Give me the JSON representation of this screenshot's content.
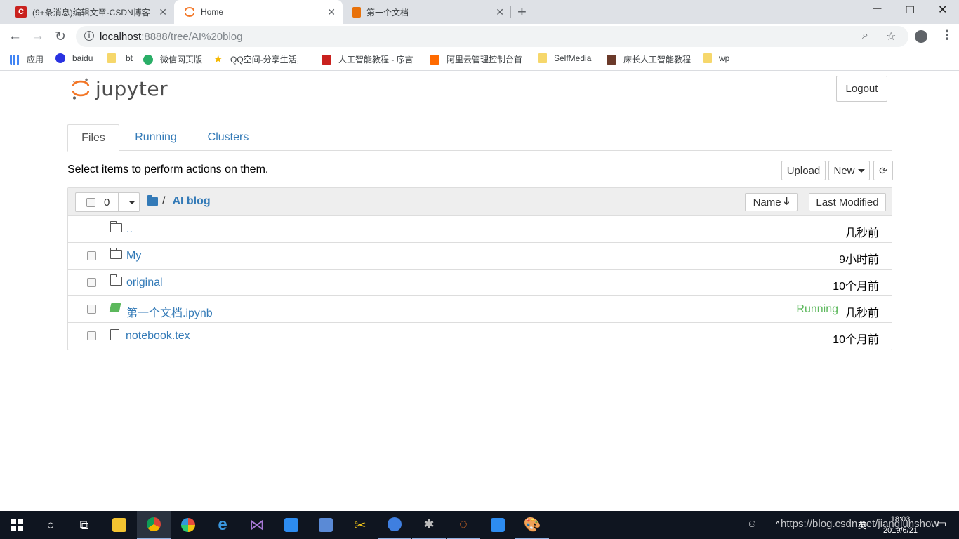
{
  "browser": {
    "tabs": [
      {
        "title": "(9+条消息)编辑文章-CSDN博客",
        "icon": "csdn-icon"
      },
      {
        "title": "Home",
        "icon": "jupyter-icon",
        "active": true
      },
      {
        "title": "第一个文档",
        "icon": "notebook-icon"
      }
    ],
    "url_host": "localhost",
    "url_rest": ":8888/tree/AI%20blog",
    "bookmarks": [
      {
        "label": "应用",
        "icon": "apps"
      },
      {
        "label": "baidu",
        "icon": "baidu"
      },
      {
        "label": "bt",
        "icon": "folder"
      },
      {
        "label": "微信网页版",
        "icon": "wechat"
      },
      {
        "label": "QQ空间-分享生活,",
        "icon": "star"
      },
      {
        "label": "人工智能教程 - 序言",
        "icon": "csdn"
      },
      {
        "label": "阿里云管理控制台首",
        "icon": "aliyun"
      },
      {
        "label": "SelfMedia",
        "icon": "folder"
      },
      {
        "label": "床长人工智能教程",
        "icon": "pic"
      },
      {
        "label": "wp",
        "icon": "folder"
      }
    ]
  },
  "jupyter": {
    "logo_text": "jupyter",
    "logout_label": "Logout",
    "tabs": [
      {
        "label": "Files",
        "active": true
      },
      {
        "label": "Running"
      },
      {
        "label": "Clusters"
      }
    ],
    "select_hint": "Select items to perform actions on them.",
    "upload_label": "Upload",
    "new_label": "New",
    "selected_count": "0",
    "breadcrumb_separator": "/",
    "breadcrumb_current": "AI blog",
    "sort_name_label": "Name",
    "sort_modified_label": "Last Modified",
    "rows": [
      {
        "name": "..",
        "type": "folder",
        "time": "几秒前",
        "checkbox": false
      },
      {
        "name": "My",
        "type": "folder",
        "time": "9小时前",
        "checkbox": true
      },
      {
        "name": "original",
        "type": "folder",
        "time": "10个月前",
        "checkbox": true
      },
      {
        "name": "第一个文档.ipynb",
        "type": "notebook",
        "time": "几秒前",
        "status": "Running",
        "checkbox": true
      },
      {
        "name": "notebook.tex",
        "type": "file",
        "time": "10个月前",
        "checkbox": true
      }
    ]
  },
  "taskbar": {
    "clock_time": "18:03",
    "clock_date": "2019/6/21",
    "ime": "英",
    "watermark": "https://blog.csdn.net/jiangjunshow"
  }
}
